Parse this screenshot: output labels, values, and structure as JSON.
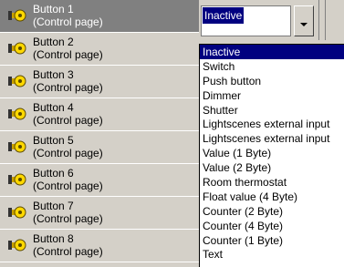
{
  "buttons": [
    {
      "title": "Button 1",
      "subtitle": "(Control page)",
      "selected": true
    },
    {
      "title": "Button 2",
      "subtitle": "(Control page)"
    },
    {
      "title": "Button 3",
      "subtitle": "(Control page)"
    },
    {
      "title": "Button 4",
      "subtitle": "(Control page)"
    },
    {
      "title": "Button 5",
      "subtitle": "(Control page)"
    },
    {
      "title": "Button 6",
      "subtitle": "(Control page)"
    },
    {
      "title": "Button 7",
      "subtitle": "(Control page)"
    },
    {
      "title": "Button 8",
      "subtitle": "(Control page)"
    }
  ],
  "combo": {
    "value": "Inactive"
  },
  "options": [
    "Inactive",
    "Switch",
    "Push button",
    "Dimmer",
    "Shutter",
    "Lightscenes external input",
    "Lightscenes external input",
    "Value (1 Byte)",
    "Value (2 Byte)",
    "Room thermostat",
    "Float value (4 Byte)",
    "Counter (2 Byte)",
    "Counter (4 Byte)",
    "Counter (1 Byte)",
    "Text"
  ],
  "icons": {
    "button_icon": "pushbutton-icon",
    "dropdown_arrow": "chevron-down-icon"
  }
}
